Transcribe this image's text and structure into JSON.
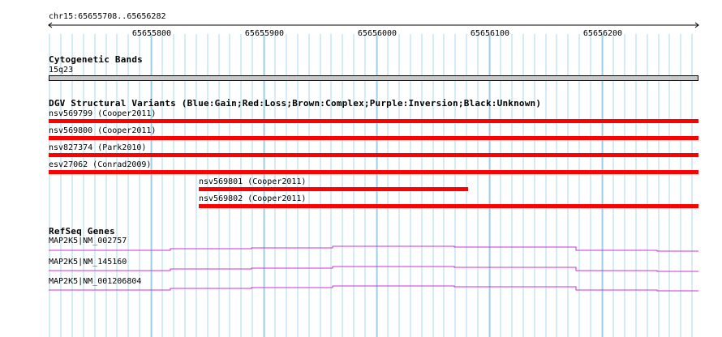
{
  "ruler": {
    "position": "chr15:65655708..65656282",
    "ticks": [
      "65655800",
      "65655900",
      "65656000",
      "65656100",
      "65656200"
    ]
  },
  "cytoband": {
    "title": "Cytogenetic Bands",
    "band": "15q23"
  },
  "dgv": {
    "title": "DGV Structural Variants (Blue:Gain;Red:Loss;Brown:Complex;Purple:Inversion;Black:Unknown)",
    "color": "#ff0000",
    "variants": [
      {
        "label": "nsv569799 (Cooper2011)"
      },
      {
        "label": "nsv569800 (Cooper2011)"
      },
      {
        "label": "nsv827374 (Park2010)"
      },
      {
        "label": "esv27062 (Conrad2009)"
      },
      {
        "label": "nsv569801 (Cooper2011)"
      },
      {
        "label": "nsv569802 (Cooper2011)"
      }
    ]
  },
  "refseq": {
    "title": "RefSeq Genes",
    "color": "#cc33cc",
    "genes": [
      {
        "label": "MAP2K5|NM_002757"
      },
      {
        "label": "MAP2K5|NM_145160"
      },
      {
        "label": "MAP2K5|NM_001206804"
      }
    ]
  },
  "colors": {
    "gridline": "#a8d8ec",
    "loss": "#ff0000",
    "gene": "#cc33cc"
  }
}
